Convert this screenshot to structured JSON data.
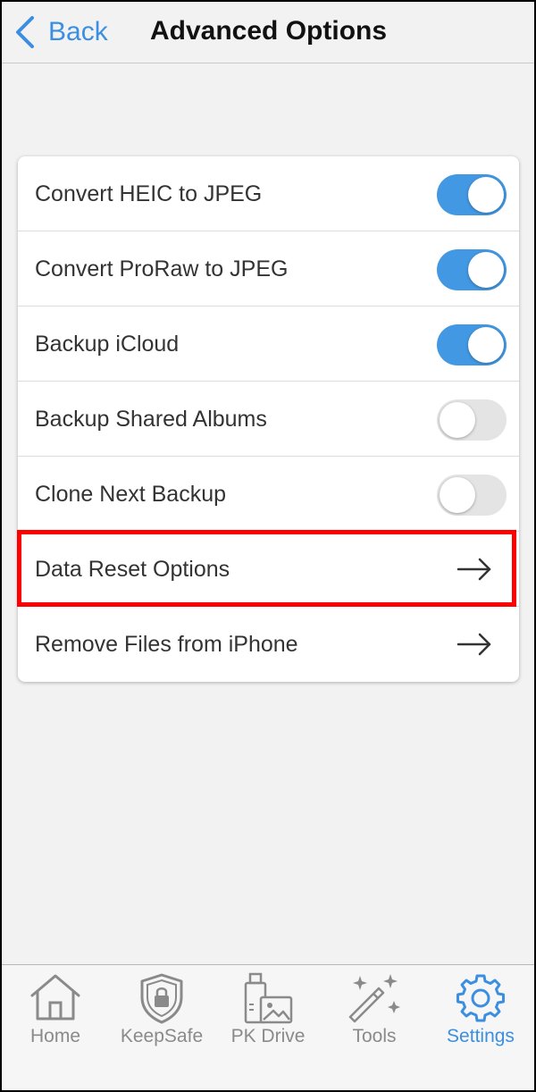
{
  "navbar": {
    "back_label": "Back",
    "title": "Advanced Options"
  },
  "settings": {
    "rows": [
      {
        "label": "Convert HEIC to JPEG",
        "control": "toggle",
        "on": true
      },
      {
        "label": "Convert ProRaw to JPEG",
        "control": "toggle",
        "on": true
      },
      {
        "label": "Backup iCloud",
        "control": "toggle",
        "on": true
      },
      {
        "label": "Backup Shared Albums",
        "control": "toggle",
        "on": false
      },
      {
        "label": "Clone Next Backup",
        "control": "toggle",
        "on": false
      },
      {
        "label": "Data Reset Options",
        "control": "arrow-right-icon",
        "highlighted": true
      },
      {
        "label": "Remove Files from iPhone",
        "control": "arrow-right-icon"
      }
    ]
  },
  "tabbar": {
    "tabs": [
      {
        "label": "Home",
        "icon": "home-icon",
        "active": false
      },
      {
        "label": "KeepSafe",
        "icon": "shield-lock-icon",
        "active": false
      },
      {
        "label": "PK Drive",
        "icon": "usb-drive-image-icon",
        "active": false
      },
      {
        "label": "Tools",
        "icon": "magic-wand-icon",
        "active": false
      },
      {
        "label": "Settings",
        "icon": "gear-icon",
        "active": true
      }
    ]
  },
  "colors": {
    "accent": "#3b8ee0",
    "toggle_on": "#4298e3",
    "toggle_off": "#e4e4e4",
    "highlight": "#ff0000",
    "tab_inactive": "#8a8a8a"
  }
}
